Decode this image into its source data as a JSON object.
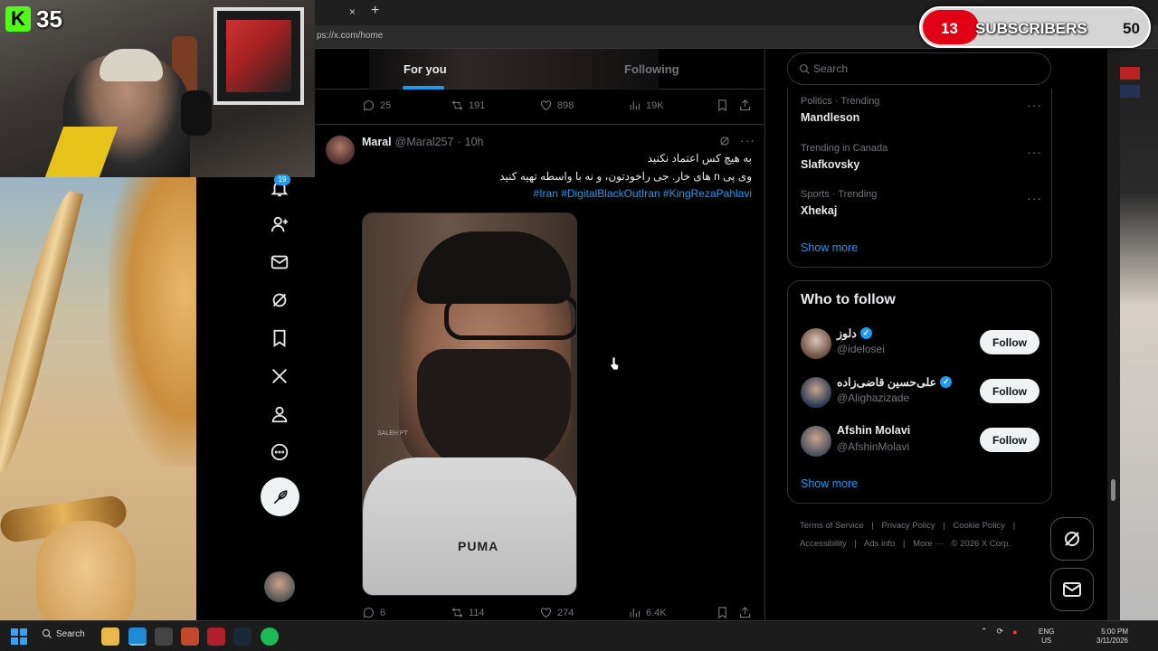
{
  "stream": {
    "kick_count": "35",
    "subscribers": {
      "current": "13",
      "label": "SUBSCRIBERS",
      "target": "50",
      "progress": 0.26
    }
  },
  "browser": {
    "url": "ps://x.com/home",
    "tab_close": "×",
    "tab_new": "+"
  },
  "nav": {
    "notifications_badge": "19",
    "icons": [
      "bell-icon",
      "follow-icon",
      "mail-icon",
      "grok-icon",
      "bookmark-icon",
      "x-logo-icon",
      "profile-icon",
      "more-icon"
    ]
  },
  "feed": {
    "tabs": {
      "for_you": "For you",
      "following": "Following"
    },
    "prev_tweet_stats": {
      "replies": "25",
      "reposts": "191",
      "likes": "898",
      "views": "19K"
    },
    "tweet": {
      "name": "Maral",
      "handle": "@Maral257",
      "dot": "·",
      "time": "10h",
      "more": "···",
      "line1": "به هیچ کس اعتماد نکنید",
      "line2": "وی پی n های خار. جی راخودتون، و نه با واسطه تهیه کنید",
      "hashtags": "#Iran #DigitalBlackOutIran  #KingRezaPahlavi",
      "video_logo": "PUMA",
      "video_watermark": "SALEH PT",
      "stats": {
        "replies": "6",
        "reposts": "114",
        "likes": "274",
        "views": "6.4K"
      }
    }
  },
  "sidebar": {
    "search_placeholder": "Search",
    "trends": [
      {
        "meta": "Politics · Trending",
        "name": "Mandleson"
      },
      {
        "meta": "Trending in Canada",
        "name": "Slafkovsky"
      },
      {
        "meta": "Sports · Trending",
        "name": "Xhekaj"
      }
    ],
    "trend_more": "···",
    "trends_show_more": "Show more",
    "who_to_follow": {
      "title": "Who to follow",
      "accounts": [
        {
          "name": "دلوز",
          "handle": "@idelosei",
          "verified": true,
          "button": "Follow"
        },
        {
          "name": "علی‌حسین قاضی‌زاده",
          "handle": "@Alighazizade",
          "verified": true,
          "button": "Follow"
        },
        {
          "name": "Afshin Molavi",
          "handle": "@AfshinMolavi",
          "verified": false,
          "button": "Follow"
        }
      ],
      "show_more": "Show more"
    },
    "footer": {
      "terms": "Terms of Service",
      "privacy": "Privacy Policy",
      "cookies": "Cookie Policy",
      "accessibility": "Accessibility",
      "ads": "Ads info",
      "more": "More ···",
      "copyright": "© 2026 X Corp.",
      "sep": "|"
    }
  },
  "taskbar": {
    "search": "Search",
    "lang_top": "ENG",
    "lang_bottom": "US",
    "time": "5:00 PM",
    "date": "3/11/2026"
  },
  "colors": {
    "accent": "#1d9bf0",
    "kick": "#53fc18",
    "sub_bar": "#e10016"
  }
}
